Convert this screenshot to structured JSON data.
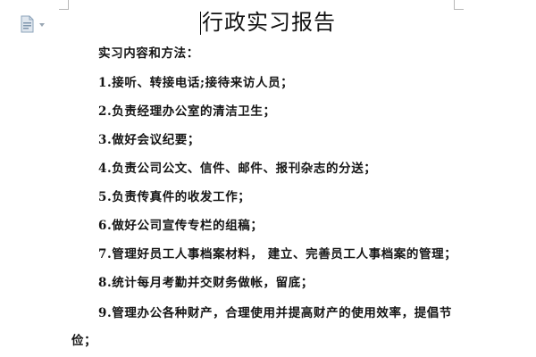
{
  "document": {
    "title": "行政实习报告",
    "lines": [
      "实习内容和方法：",
      "1.接听、转接电话;接待来访人员；",
      "2.负责经理办公室的清洁卫生；",
      "3.做好会议纪要；",
      "4.负责公司公文、信件、邮件、报刊杂志的分送；",
      "5.负责传真件的收发工作；",
      "6.做好公司宣传专栏的组稿；",
      "7.管理好员工人事档案材料， 建立、完善员工人事档案的管理；",
      "8.统计每月考勤并交财务做帐，留底；",
      "9.管理办公各种财产，合理使用并提高财产的使用效率，提倡节",
      "俭；"
    ]
  },
  "icons": {
    "paragraph_marker": "paragraph-format-icon"
  }
}
